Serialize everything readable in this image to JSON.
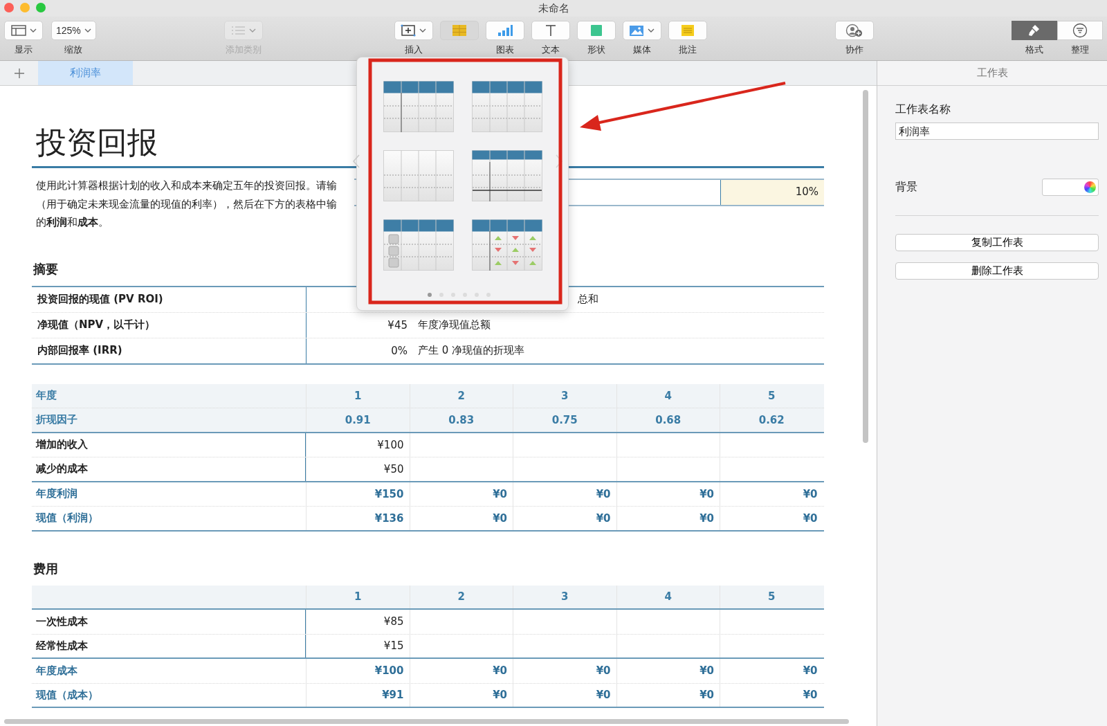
{
  "window": {
    "title": "未命名"
  },
  "toolbar": {
    "groups": [
      {
        "kind": "view",
        "items": [
          {
            "kind": "layout",
            "label": "显示",
            "disabled": false,
            "selected": false
          },
          {
            "kind": "zoom",
            "value": "125%",
            "label": "缩放",
            "disabled": false,
            "selected": false
          }
        ]
      },
      {
        "kind": "category",
        "items": [
          {
            "kind": "list",
            "label": "添加类别",
            "disabled": true,
            "selected": false
          }
        ]
      },
      {
        "kind": "insert",
        "items": [
          {
            "kind": "insert",
            "label": "插入",
            "disabled": false,
            "selected": false
          },
          {
            "kind": "table",
            "disabled": false,
            "selected": true
          },
          {
            "kind": "chart",
            "label": "图表",
            "disabled": false,
            "selected": false
          },
          {
            "kind": "text",
            "label": "文本",
            "disabled": false,
            "selected": false
          },
          {
            "kind": "shape",
            "label": "形状",
            "disabled": false,
            "selected": false
          },
          {
            "kind": "media",
            "label": "媒体",
            "disabled": false,
            "selected": false
          },
          {
            "kind": "comment",
            "label": "批注",
            "disabled": false,
            "selected": false
          }
        ]
      },
      {
        "kind": "collab",
        "items": [
          {
            "kind": "collab",
            "label": "协作",
            "disabled": false,
            "selected": false
          }
        ]
      },
      {
        "kind": "inspector",
        "items": [
          {
            "kind": "format",
            "label": "格式",
            "disabled": false,
            "selected": true
          },
          {
            "kind": "organize",
            "label": "整理",
            "disabled": false,
            "selected": false
          }
        ]
      }
    ]
  },
  "sheet_tabs": [
    {
      "label": "利润率",
      "selected": true
    }
  ],
  "document": {
    "title": "投资回报",
    "intro": [
      "使用此计算器根据计划的收入和成本来确定五年的投资回报。请输",
      "（用于确定未来现金流量的现值的利率），然后在下方的表格中输",
      "的**利润**和**成本**。"
    ],
    "rate": {
      "value": "10%"
    },
    "summary": {
      "heading": "摘要",
      "rows": [
        {
          "label": "投资回报的现值 (PV ROI)",
          "note": "总和"
        },
        {
          "label": "净现值（NPV，以千计）",
          "value": "¥45",
          "note": "年度净现值总额"
        },
        {
          "label": "内部回报率 (IRR)",
          "value": "0%",
          "note": "产生 0 净现值的折现率"
        }
      ]
    },
    "returns": {
      "rows": [
        {
          "kind": "header",
          "label": "年度",
          "values": [
            "1",
            "2",
            "3",
            "4",
            "5"
          ]
        },
        {
          "kind": "header",
          "label": "折现因子",
          "values": [
            "0.91",
            "0.83",
            "0.75",
            "0.68",
            "0.62"
          ]
        },
        {
          "kind": "input",
          "label": "增加的收入",
          "values": [
            "¥100"
          ]
        },
        {
          "kind": "input",
          "label": "减少的成本",
          "values": [
            "¥50"
          ]
        },
        {
          "kind": "total",
          "label": "年度利润",
          "values": [
            "¥150",
            "¥0",
            "¥0",
            "¥0",
            "¥0"
          ]
        },
        {
          "kind": "total",
          "label": "现值（利润）",
          "values": [
            "¥136",
            "¥0",
            "¥0",
            "¥0",
            "¥0"
          ]
        }
      ]
    },
    "costs": {
      "heading": "费用",
      "rows": [
        {
          "kind": "header",
          "values": [
            "1",
            "2",
            "3",
            "4",
            "5"
          ]
        },
        {
          "kind": "input",
          "label": "一次性成本",
          "values": [
            "¥85"
          ]
        },
        {
          "kind": "input",
          "label": "经常性成本",
          "values": [
            "¥15"
          ]
        },
        {
          "kind": "total",
          "label": "年度成本",
          "values": [
            "¥100",
            "¥0",
            "¥0",
            "¥0",
            "¥0"
          ]
        },
        {
          "kind": "total",
          "label": "现值（成本）",
          "values": [
            "¥91",
            "¥0",
            "¥0",
            "¥0",
            "¥0"
          ]
        }
      ]
    }
  },
  "table_styles": {
    "styles": [
      {
        "kind": "header-column"
      },
      {
        "kind": "header"
      },
      {
        "kind": "plain"
      },
      {
        "kind": "header-footer"
      },
      {
        "kind": "checkbox"
      },
      {
        "kind": "arrows"
      }
    ],
    "pages": [
      {
        "selected": true
      },
      {
        "selected": false
      },
      {
        "selected": false
      },
      {
        "selected": false
      },
      {
        "selected": false
      },
      {
        "selected": false
      }
    ]
  },
  "inspector": {
    "tab": "工作表",
    "name_label": "工作表名称",
    "name_value": "利润率",
    "background_label": "背景",
    "buttons": [
      "复制工作表",
      "删除工作表"
    ]
  }
}
